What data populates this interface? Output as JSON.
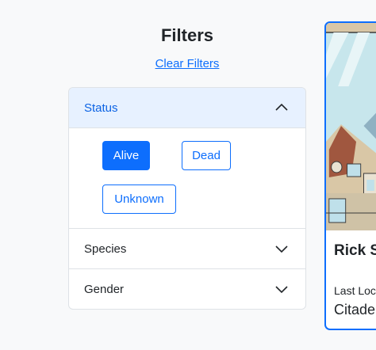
{
  "filters": {
    "title": "Filters",
    "clear_label": "Clear Filters",
    "sections": [
      {
        "label": "Status",
        "expanded": true,
        "options": [
          {
            "label": "Alive",
            "selected": true
          },
          {
            "label": "Dead",
            "selected": false
          },
          {
            "label": "Unknown",
            "selected": false
          }
        ]
      },
      {
        "label": "Species",
        "expanded": false
      },
      {
        "label": "Gender",
        "expanded": false
      }
    ]
  },
  "card": {
    "name": "Rick S",
    "location_label": "Last Loc",
    "location_value": "Citade"
  },
  "colors": {
    "accent": "#0d6efd",
    "header_active_bg": "#e7f1ff"
  },
  "icons": {
    "expanded": "chevron-up-icon",
    "collapsed": "chevron-down-icon"
  }
}
